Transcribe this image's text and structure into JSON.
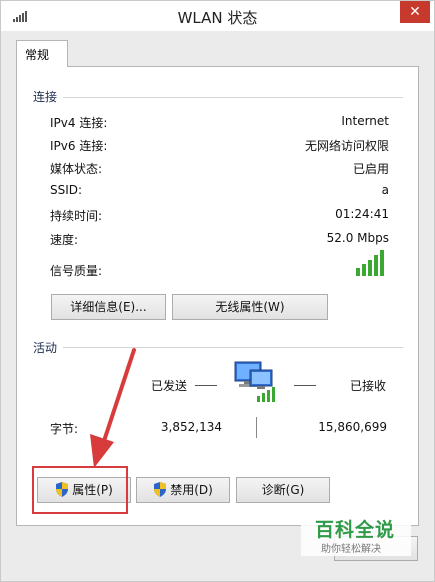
{
  "window": {
    "title": "WLAN 状态",
    "close_label": "✕"
  },
  "tabs": [
    {
      "label": "常规"
    }
  ],
  "connection": {
    "group_title": "连接",
    "rows": [
      {
        "label": "IPv4 连接:",
        "value": "Internet"
      },
      {
        "label": "IPv6 连接:",
        "value": "无网络访问权限"
      },
      {
        "label": "媒体状态:",
        "value": "已启用"
      },
      {
        "label": "SSID:",
        "value": "a"
      },
      {
        "label": "持续时间:",
        "value": "01:24:41"
      },
      {
        "label": "速度:",
        "value": "52.0 Mbps"
      },
      {
        "label": "信号质量:",
        "value": ""
      }
    ],
    "details_button": "详细信息(E)...",
    "wireless_props_button": "无线属性(W)"
  },
  "activity": {
    "group_title": "活动",
    "sent_label": "已发送",
    "received_label": "已接收",
    "bytes_label": "字节:",
    "bytes_sent": "3,852,134",
    "bytes_received": "15,860,699"
  },
  "actions": {
    "properties_button": "属性(P)",
    "disable_button": "禁用(D)",
    "diagnose_button": "诊断(G)"
  },
  "watermark": {
    "title": "百科全说",
    "subtitle": "助你轻松解决"
  },
  "colors": {
    "accent_red": "#d83b3b",
    "close_red": "#c7392d",
    "watermark_green": "#2f9a48",
    "signal_green": "#3aa832"
  }
}
